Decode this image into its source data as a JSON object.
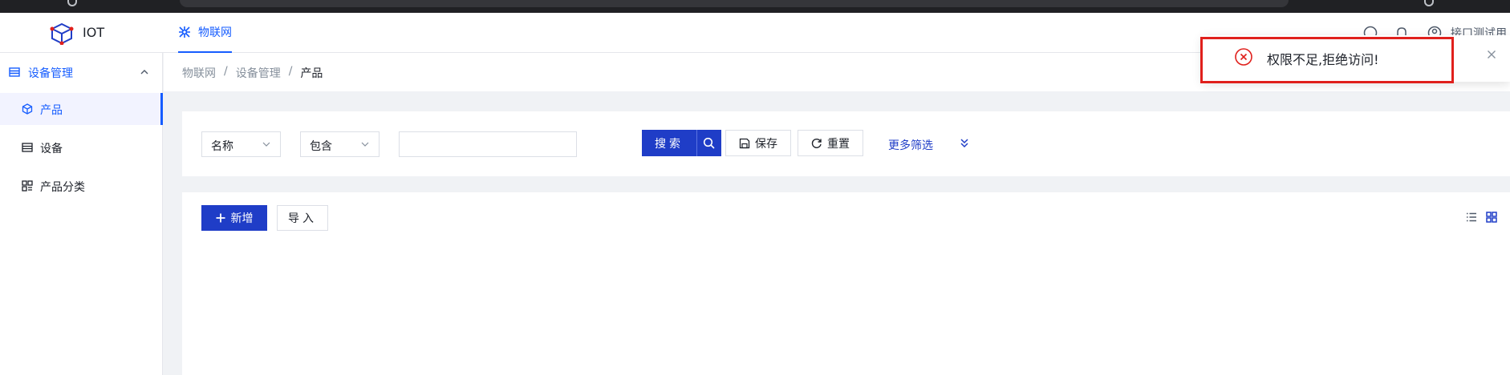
{
  "app": {
    "title": "IOT"
  },
  "header": {
    "tabs": [
      {
        "label": "物联网",
        "active": true
      }
    ],
    "user_label": "接口测试用"
  },
  "sidebar": {
    "group": {
      "label": "设备管理",
      "expanded": true
    },
    "items": [
      {
        "label": "产品",
        "icon": "cube-icon",
        "active": true
      },
      {
        "label": "设备",
        "icon": "device-list-icon",
        "active": false
      },
      {
        "label": "产品分类",
        "icon": "category-grid-icon",
        "active": false
      }
    ]
  },
  "breadcrumb": [
    "物联网",
    "设备管理",
    "产品"
  ],
  "filter": {
    "field_select": "名称",
    "operator_select": "包含",
    "keyword_value": "",
    "search_label": "搜索",
    "save_label": "保存",
    "reset_label": "重置",
    "more_label": "更多筛选"
  },
  "toolbar": {
    "add_label": "新增",
    "import_label": "导入"
  },
  "toast": {
    "message": "权限不足,拒绝访问!",
    "type": "error"
  },
  "colors": {
    "primary": "#1f3dc7",
    "accent": "#165dff",
    "error": "#e0201c"
  }
}
